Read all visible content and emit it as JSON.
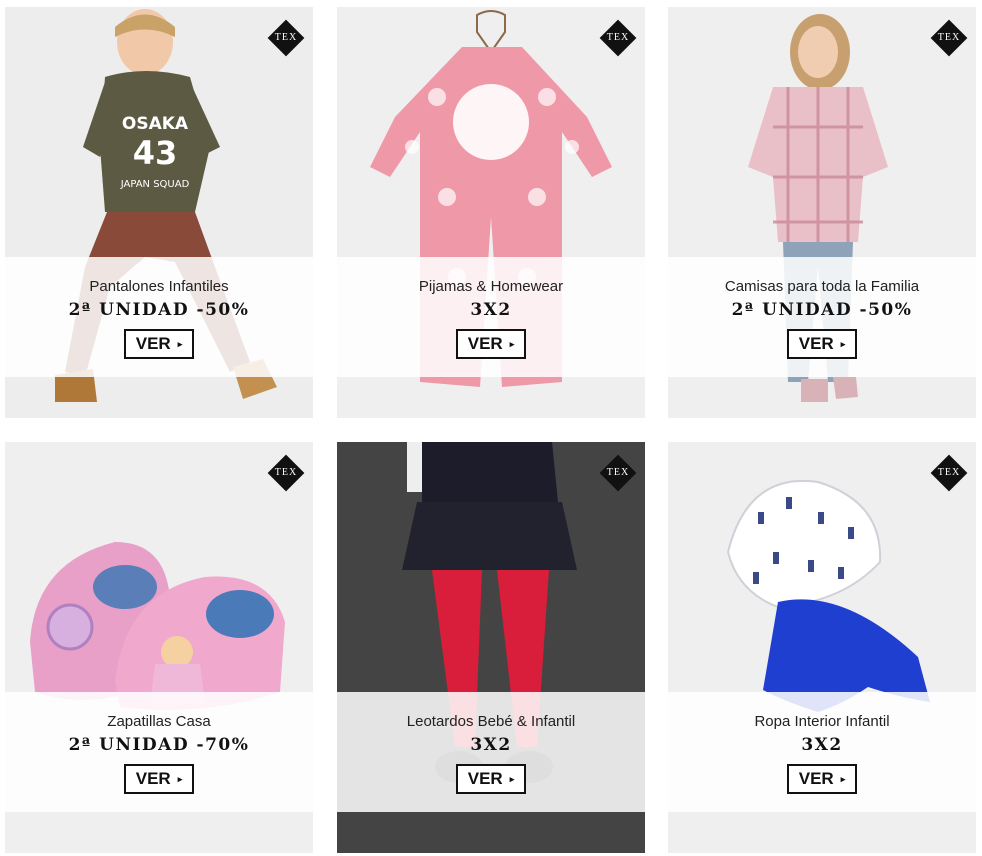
{
  "badge_label": "TEX",
  "colors": {
    "button_border": "#111111",
    "badge": "#111111",
    "panel": "#ffffff"
  },
  "cards": [
    {
      "title": "Pantalones Infantiles",
      "promo": "2ª UNIDAD -50%",
      "button": "VER",
      "arrow": "▸",
      "print": {
        "l1": "OSAKA",
        "l2": "43",
        "l3": "JAPAN SQUAD"
      }
    },
    {
      "title": "Pijamas & Homewear",
      "promo": "3X2",
      "button": "VER",
      "arrow": "▸"
    },
    {
      "title": "Camisas para toda la Familia",
      "promo": "2ª UNIDAD -50%",
      "button": "VER",
      "arrow": "▸"
    },
    {
      "title": "Zapatillas Casa",
      "promo": "2ª UNIDAD -70%",
      "button": "VER",
      "arrow": "▸"
    },
    {
      "title": "Leotardos Bebé & Infantil",
      "promo": "3X2",
      "button": "VER",
      "arrow": "▸"
    },
    {
      "title": "Ropa Interior Infantil",
      "promo": "3X2",
      "button": "VER",
      "arrow": "▸"
    }
  ]
}
